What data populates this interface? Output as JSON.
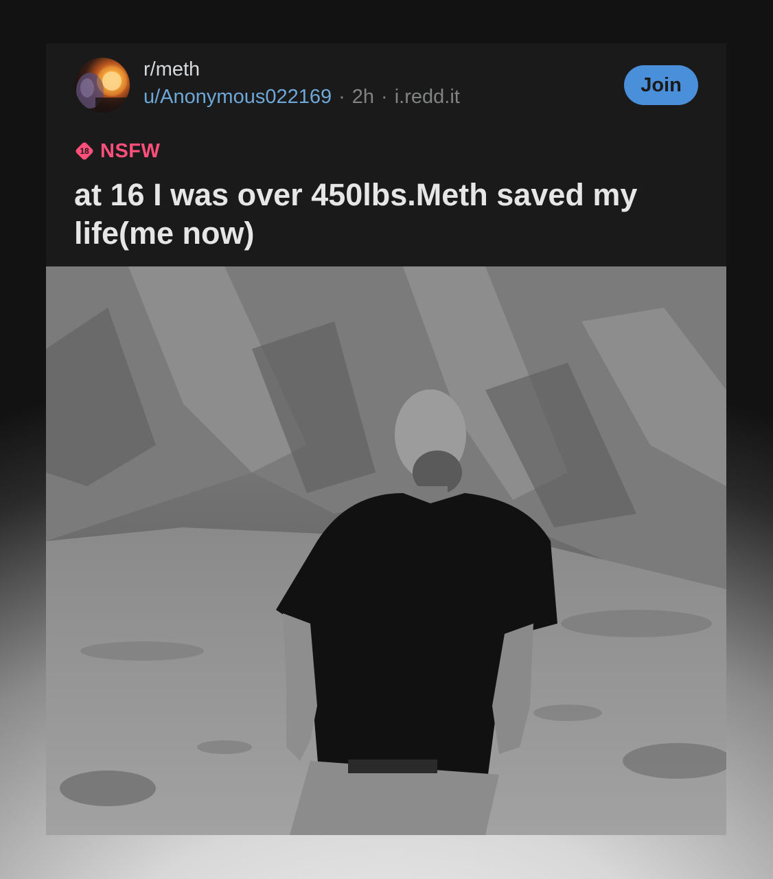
{
  "post": {
    "subreddit": "r/meth",
    "username": "u/Anonymous022169",
    "time_ago": "2h",
    "domain": "i.redd.it",
    "join_label": "Join",
    "nsfw_badge_number": "18",
    "nsfw_label": "NSFW",
    "title": "at 16 I was over 450lbs.Meth saved my life(me now)"
  },
  "colors": {
    "card_background": "#1a1a1b",
    "nsfw": "#ff4f7a",
    "join_button": "#4a8fd9",
    "username": "#6ea8d8"
  },
  "icons": {
    "nsfw_badge": "nsfw-18-icon",
    "subreddit_avatar": "subreddit-avatar"
  }
}
